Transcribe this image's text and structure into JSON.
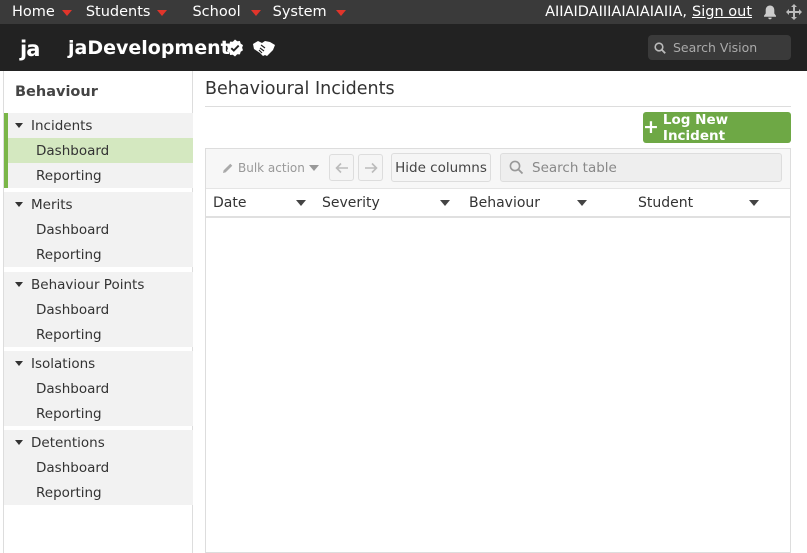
{
  "topnav": {
    "items": [
      {
        "label": "Home"
      },
      {
        "label": "Students"
      },
      {
        "label": "School"
      },
      {
        "label": "System"
      }
    ],
    "user_text": "AIIAIDAIIIAIAIAIAIIA,",
    "signout_label": "Sign out",
    "icons": [
      "bell-icon",
      "move-icon"
    ]
  },
  "brand": {
    "logo_text": "ja",
    "name": "jaDevelopment",
    "icons": [
      "verified-badge-icon",
      "handshake-icon"
    ],
    "search_placeholder": "Search Vision"
  },
  "sidebar": {
    "title": "Behaviour",
    "sections": [
      {
        "label": "Incidents",
        "items": [
          "Dashboard",
          "Reporting"
        ]
      },
      {
        "label": "Merits",
        "items": [
          "Dashboard",
          "Reporting"
        ]
      },
      {
        "label": "Behaviour Points",
        "items": [
          "Dashboard",
          "Reporting"
        ]
      },
      {
        "label": "Isolations",
        "items": [
          "Dashboard",
          "Reporting"
        ]
      },
      {
        "label": "Detentions",
        "items": [
          "Dashboard",
          "Reporting"
        ]
      }
    ],
    "selected": "Incidents / Dashboard"
  },
  "main": {
    "title": "Behavioural Incidents",
    "log_button": "Log New Incident",
    "toolbar": {
      "bulk_action": "Bulk action",
      "hide_columns": "Hide columns",
      "search_placeholder": "Search table"
    },
    "columns": [
      "Date",
      "Severity",
      "Behaviour",
      "Student"
    ]
  },
  "colors": {
    "accent_green": "#6ea845",
    "selected_bg": "#d4e8c0",
    "menu_caret": "#e0352b",
    "brand_bar": "#222222"
  }
}
